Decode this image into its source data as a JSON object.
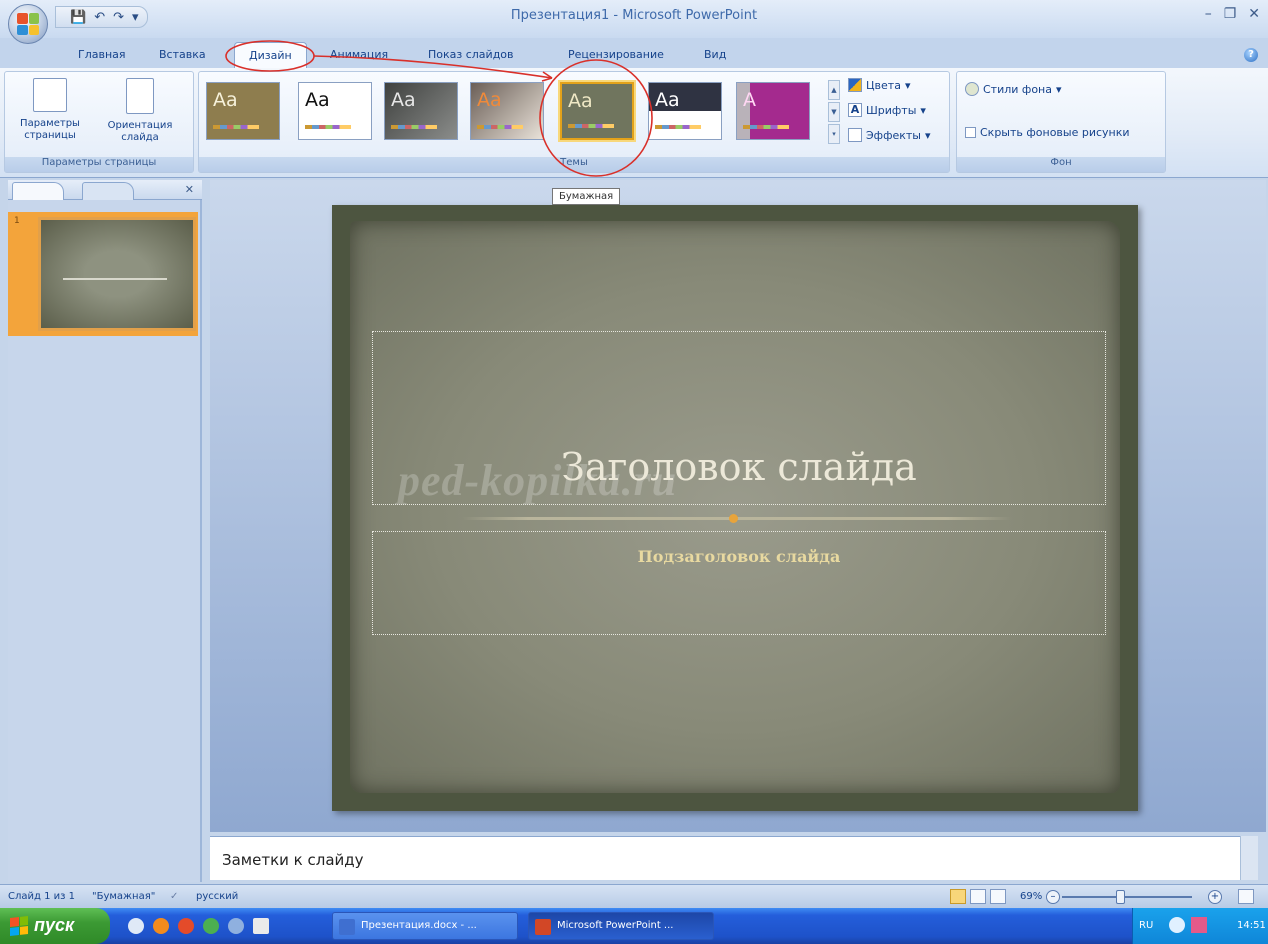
{
  "window": {
    "title": "Презентация1 - Microsoft PowerPoint"
  },
  "tabs": [
    {
      "label": "Главная"
    },
    {
      "label": "Вставка"
    },
    {
      "label": "Дизайн"
    },
    {
      "label": "Анимация"
    },
    {
      "label": "Показ слайдов"
    },
    {
      "label": "Рецензирование"
    },
    {
      "label": "Вид"
    }
  ],
  "active_tab": "Дизайн",
  "ribbon": {
    "page_setup": {
      "params_label": "Параметры страницы",
      "orientation_label": "Ориентация слайда",
      "group_label": "Параметры страницы"
    },
    "themes": {
      "group_label": "Темы",
      "selected_tooltip": "Бумажная",
      "items": [
        {
          "label": "Aa",
          "bg": "#8e7d4e",
          "fg": "#f6f1da",
          "icon": "theme-office-paper"
        },
        {
          "label": "Aa",
          "bg": "#ffffff",
          "fg": "#111111",
          "icon": "theme-default"
        },
        {
          "label": "Aa",
          "bg": "#5b5e5b",
          "fg": "#e6e6e6",
          "icon": "theme-metro"
        },
        {
          "label": "Aa",
          "bg": "#d9d0c7",
          "fg": "#e2782a",
          "icon": "theme-apex"
        },
        {
          "label": "Aa",
          "bg": "#70755e",
          "fg": "#efe8c5",
          "icon": "theme-paper"
        },
        {
          "label": "Aa",
          "bg": "#2f3342",
          "fg": "#ffffff",
          "icon": "theme-civic"
        },
        {
          "label": "A",
          "bg": "#a42a8e",
          "fg": "#ffd6f3",
          "icon": "theme-flow"
        }
      ],
      "colors_label": "Цвета",
      "fonts_label": "Шрифты",
      "effects_label": "Эффекты"
    },
    "background": {
      "styles_label": "Стили фона",
      "hide_label": "Скрыть фоновые рисунки",
      "group_label": "Фон"
    }
  },
  "slide": {
    "number": "1",
    "title": "Заголовок слайда",
    "subtitle": "Подзаголовок слайда",
    "watermark": "ped-kopilka.ru"
  },
  "notes_placeholder": "Заметки к слайду",
  "status": {
    "slide_info": "Слайд 1 из 1",
    "theme_name": "\"Бумажная\"",
    "language": "русский",
    "zoom": "69%"
  },
  "taskbar": {
    "start_label": "пуск",
    "buttons": [
      {
        "label": "Презентация.docx - ..."
      },
      {
        "label": "Microsoft PowerPoint ..."
      }
    ],
    "tray_lang": "RU",
    "clock": "14:51"
  },
  "colors": {
    "accent_ribbon": "#c2d4ec",
    "annotation_red": "#d9302a",
    "selected_theme_border": "#e3a21a"
  }
}
